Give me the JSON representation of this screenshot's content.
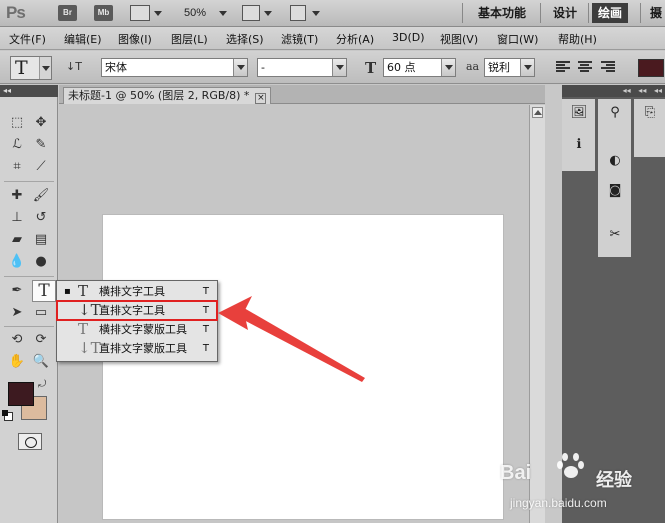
{
  "appbar": {
    "logo": "Ps",
    "bridge_label": "Br",
    "minibridge_label": "Mb",
    "zoom": "50%",
    "workspaces": [
      "基本功能",
      "设计",
      "绘画",
      "摄"
    ],
    "active_workspace_index": 2
  },
  "menu": {
    "items": [
      "文件(F)",
      "编辑(E)",
      "图像(I)",
      "图层(L)",
      "选择(S)",
      "滤镜(T)",
      "分析(A)",
      "3D(D)",
      "视图(V)",
      "窗口(W)",
      "帮助(H)"
    ]
  },
  "options": {
    "tool_glyph": "T",
    "orientation_glyph": "↓T",
    "font_family": "宋体",
    "font_style": "-",
    "size_glyph": "T",
    "font_size": "60 点",
    "aa_glyph": "aa",
    "antialias": "锐利",
    "text_color": "#4a1a1f"
  },
  "document": {
    "tab_title": "未标题-1 @ 50% (图层 2, RGB/8) *",
    "close_glyph": "×"
  },
  "toolbox": {
    "foreground_color": "#3d1a20",
    "background_color": "#dcbb9e",
    "active_tool_glyph": "T"
  },
  "flyout": {
    "items": [
      {
        "glyph": "T",
        "label": "横排文字工具",
        "shortcut": "T",
        "selected": true
      },
      {
        "glyph": "↓T",
        "label": "直排文字工具",
        "shortcut": "T",
        "highlighted": true
      },
      {
        "glyph": "T",
        "label": "横排文字蒙版工具",
        "shortcut": "T"
      },
      {
        "glyph": "↓T",
        "label": "直排文字蒙版工具",
        "shortcut": "T"
      }
    ],
    "bullet": "▪"
  },
  "watermark": {
    "brand": "Bai",
    "brand_cn": "经验",
    "url": "jingyan.baidu.com"
  },
  "colors": {
    "annotation_red": "#e02020",
    "panel_dark": "#5d5d5d"
  }
}
